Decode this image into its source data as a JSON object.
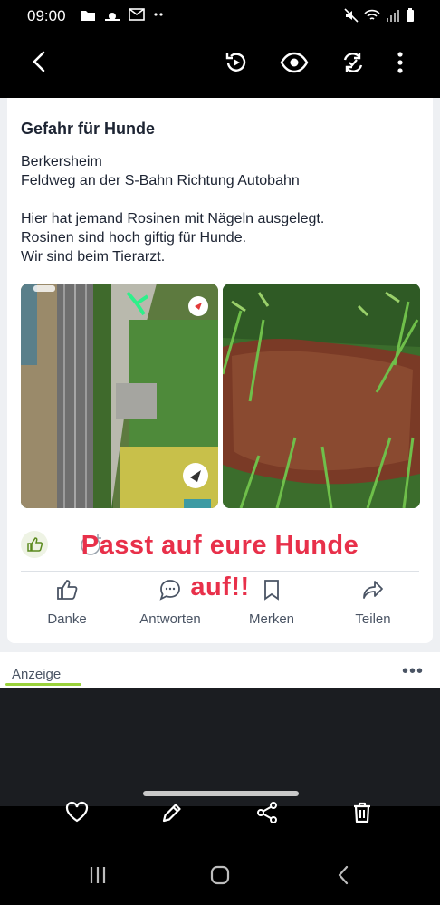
{
  "status": {
    "time": "09:00"
  },
  "post": {
    "title": "Gefahr für Hunde",
    "lines": [
      "Berkersheim",
      "Feldweg an der S-Bahn Richtung Autobahn",
      "Hier hat jemand Rosinen mit Nägeln ausgelegt.",
      "Rosinen sind hoch giftig für Hunde.",
      "Wir sind beim Tierarzt."
    ]
  },
  "overlay": {
    "line1": "Passt auf eure Hunde",
    "line2": "auf!!"
  },
  "actions": {
    "thanks": "Danke",
    "reply": "Antworten",
    "save": "Merken",
    "share": "Teilen"
  },
  "ad": {
    "label": "Anzeige",
    "more": "•••"
  },
  "colors": {
    "accent_red": "#e8304a",
    "accent_green": "#9ad23a",
    "text_dark": "#1d2433"
  },
  "icons": [
    "back-icon",
    "replay-icon",
    "eye-icon",
    "sync-icon",
    "more-vertical-icon",
    "heart-icon",
    "pencil-icon",
    "share-icon",
    "trash-icon"
  ]
}
